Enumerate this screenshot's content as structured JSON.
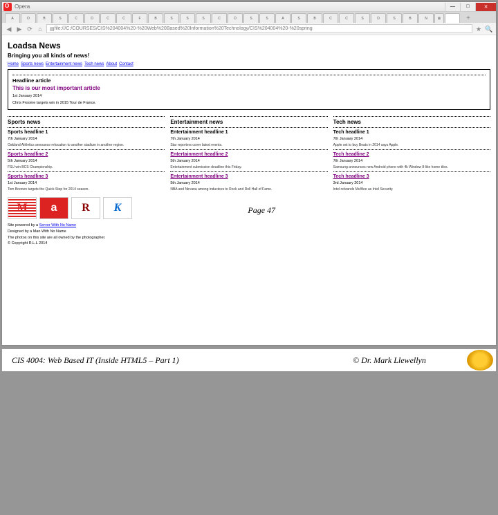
{
  "titlebar": {
    "label": "Opera"
  },
  "tabs": [
    "A",
    "O",
    "B",
    "S",
    "C",
    "D",
    "C",
    "C",
    "F",
    "B",
    "S",
    "S",
    "S",
    "C",
    "D",
    "S",
    "S",
    "A",
    "S",
    "B",
    "C",
    "C",
    "S",
    "D",
    "S",
    "B",
    "N"
  ],
  "addr": {
    "url": "file:///C:/COURSES/CIS%204004%20-%20Web%20Based%20Information%20Technology/CIS%204004%20-%20spring"
  },
  "site": {
    "title": "Loadsa News",
    "subtitle": "Bringing you all kinds of news!"
  },
  "nav": [
    "Home",
    "Sports news",
    "Entertainment news",
    "Tech news",
    "About",
    "Contact"
  ],
  "headline": {
    "label": "Headline article",
    "title": "This is our most important article",
    "date": "1st January 2014",
    "body": "Chris Froome targets win in 2015 Tour de France."
  },
  "columns": [
    {
      "title": "Sports news",
      "items": [
        {
          "h": "Sports headline 1",
          "d": "7th January 2014",
          "b": "Oakland Athletics announce relocation to another stadium in another region.",
          "link": false
        },
        {
          "h": "Sports headline 2",
          "d": "5th January 2014",
          "b": "FSU win BCS Championship.",
          "link": true
        },
        {
          "h": "Sports headline 3",
          "d": "1st January 2014",
          "b": "Tom Boonen targets the Quick-Step for 2014 season.",
          "link": true
        }
      ]
    },
    {
      "title": "Entertainment news",
      "items": [
        {
          "h": "Entertainment headline 1",
          "d": "7th January 2014",
          "b": "Star reporters cover latest events.",
          "link": false
        },
        {
          "h": "Entertainment headline 2",
          "d": "5th January 2014",
          "b": "Entertainment submission deadline this Friday.",
          "link": true
        },
        {
          "h": "Entertainment headline 3",
          "d": "5th January 2014",
          "b": "NBA and Nirvana among inductees to Rock and Roll Hall of Fame.",
          "link": true
        }
      ]
    },
    {
      "title": "Tech news",
      "items": [
        {
          "h": "Tech headline 1",
          "d": "7th January 2014",
          "b": "Apple set to buy Beats in 2014 says Apple.",
          "link": false
        },
        {
          "h": "Tech headline 2",
          "d": "7th January 2014",
          "b": "Samsung announces new Android phone with 4k Window 8-like home tiles.",
          "link": true
        },
        {
          "h": "Tech headline 3",
          "d": "3rd January 2014",
          "b": "Intel rebrands McAfee as Intel Security.",
          "link": true
        }
      ]
    }
  ],
  "thumbs": [
    "M",
    "a",
    "R",
    "K"
  ],
  "foot": {
    "l1a": "Site powered by a ",
    "l1b": "Server With No Name",
    "l2": "Designed by a Man With No Name",
    "l3": "The photos on this site are all owned by the photographer.",
    "l4": "© Copyright R.L.L 2014"
  },
  "slide": {
    "course": "CIS 4004: Web Based IT (Inside HTML5 – Part 1)",
    "page": "Page 47",
    "author": "© Dr. Mark Llewellyn"
  }
}
